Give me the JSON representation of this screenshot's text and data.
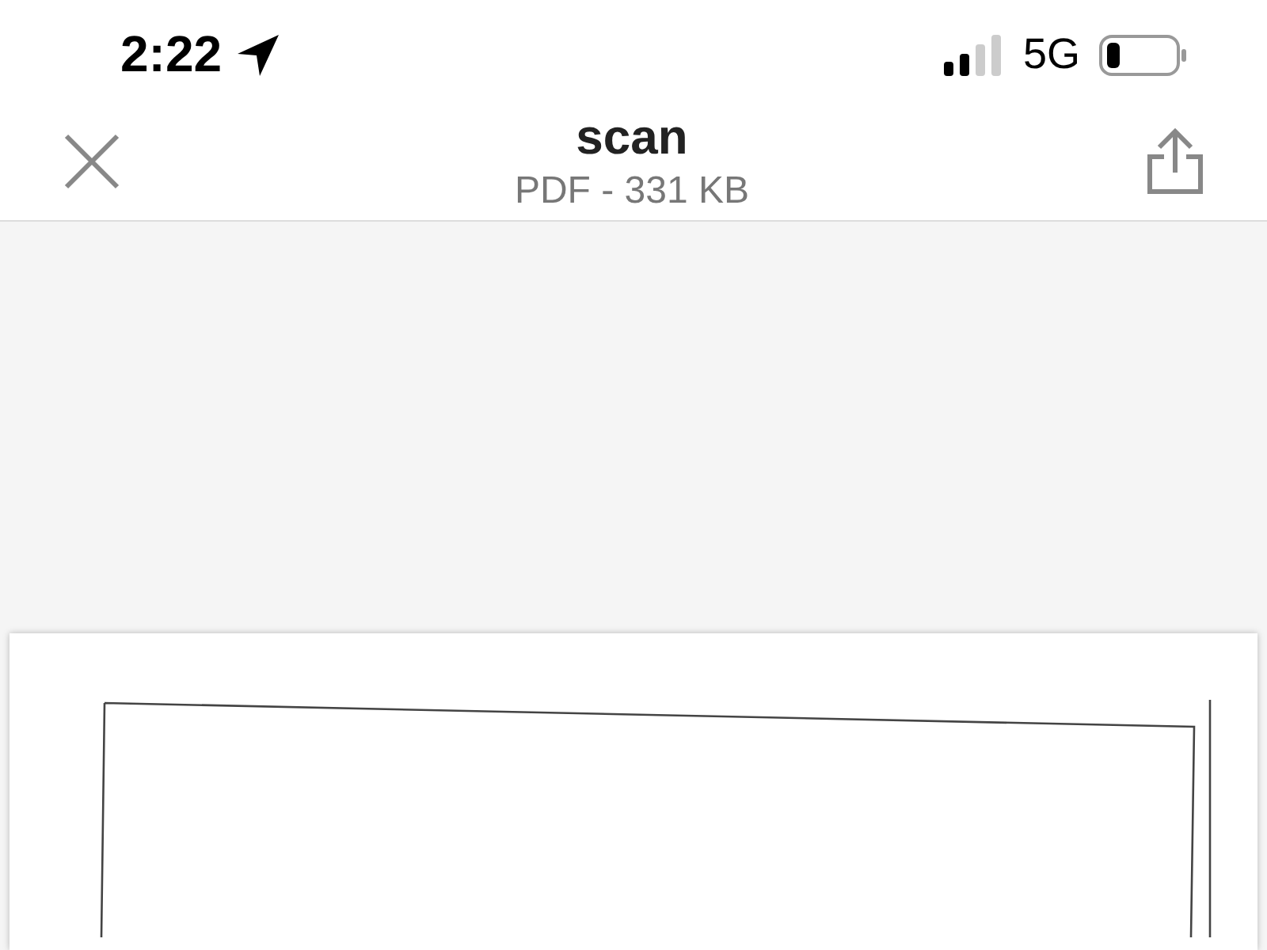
{
  "status_bar": {
    "time": "2:22",
    "network": "5G"
  },
  "header": {
    "title": "scan",
    "subtitle": "PDF - 331 KB"
  }
}
